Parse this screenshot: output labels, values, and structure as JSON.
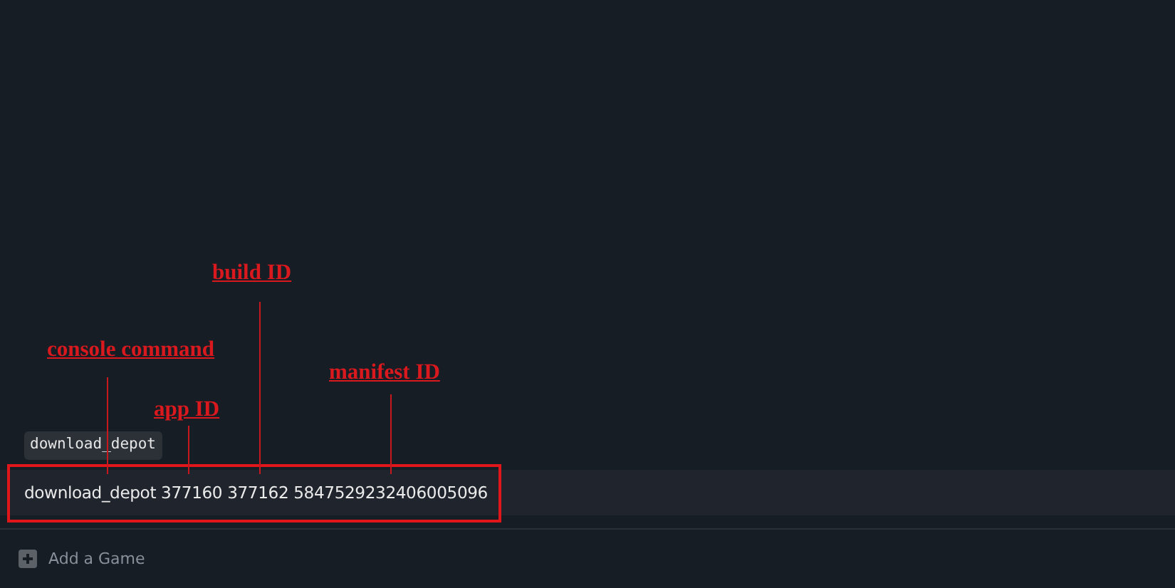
{
  "console": {
    "suggestion": "download_depot",
    "command": "download_depot 377160 377162 5847529232406005096",
    "highlighted": true
  },
  "annotations": [
    {
      "label": "console command"
    },
    {
      "label": "app ID"
    },
    {
      "label": "build ID"
    },
    {
      "label": "manifest ID"
    }
  ],
  "footer": {
    "add_game": "Add a Game"
  }
}
